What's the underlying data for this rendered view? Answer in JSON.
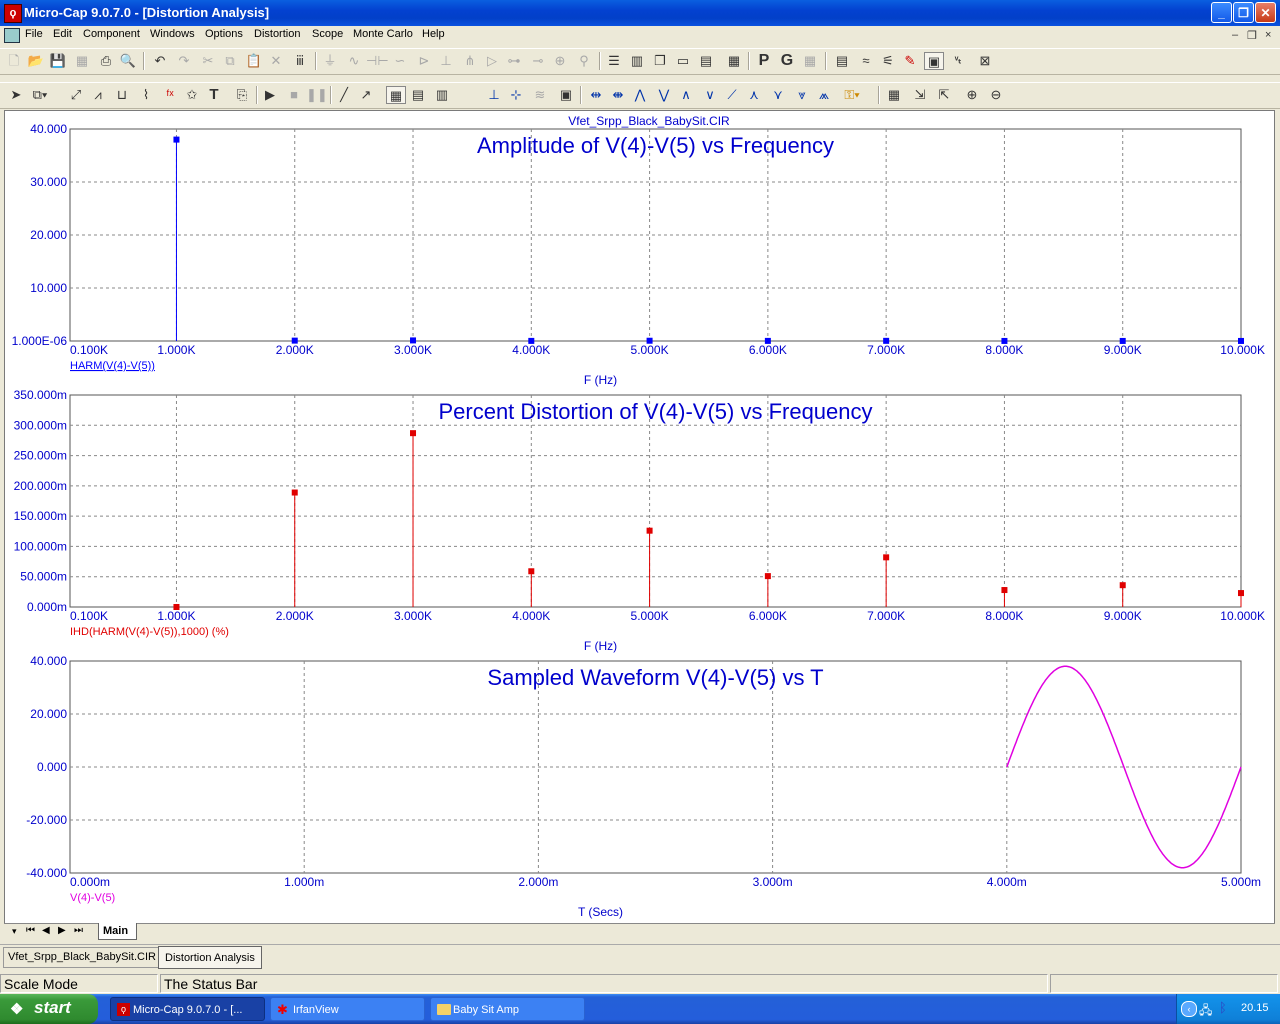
{
  "window": {
    "title": "Micro-Cap 9.0.7.0 - [Distortion Analysis]",
    "app_icon": "microcap-logo-icon",
    "buttons": [
      "minimize",
      "restore",
      "close"
    ]
  },
  "menu": [
    "File",
    "Edit",
    "Component",
    "Windows",
    "Options",
    "Distortion",
    "Scope",
    "Monte Carlo",
    "Help"
  ],
  "mdi_buttons": [
    "–",
    "❐",
    "×"
  ],
  "plot": {
    "circuit_name": "Vfet_Srpp_Black_BabySit.CIR",
    "panels": [
      {
        "title": "Amplitude of V(4)-V(5) vs Frequency",
        "y_ticks": [
          "40.000",
          "30.000",
          "20.000",
          "10.000",
          "1.000E-06"
        ],
        "x_ticks": [
          "0.100K",
          "1.000K",
          "2.000K",
          "3.000K",
          "4.000K",
          "5.000K",
          "6.000K",
          "7.000K",
          "8.000K",
          "9.000K",
          "10.000K"
        ],
        "xlabel": "F (Hz)",
        "expr": "HARM(V(4)-V(5))",
        "color": "#0000ff"
      },
      {
        "title": "Percent Distortion of V(4)-V(5) vs Frequency",
        "y_ticks": [
          "350.000m",
          "300.000m",
          "250.000m",
          "200.000m",
          "150.000m",
          "100.000m",
          "50.000m",
          "0.000m"
        ],
        "x_ticks": [
          "0.100K",
          "1.000K",
          "2.000K",
          "3.000K",
          "4.000K",
          "5.000K",
          "6.000K",
          "7.000K",
          "8.000K",
          "9.000K",
          "10.000K"
        ],
        "xlabel": "F (Hz)",
        "expr": "IHD(HARM(V(4)-V(5)),1000) (%)",
        "color": "#e00000"
      },
      {
        "title": "Sampled Waveform  V(4)-V(5) vs T",
        "y_ticks": [
          "40.000",
          "20.000",
          "0.000",
          "-20.000",
          "-40.000"
        ],
        "x_ticks": [
          "0.000m",
          "1.000m",
          "2.000m",
          "3.000m",
          "4.000m",
          "5.000m"
        ],
        "xlabel": "T (Secs)",
        "expr": "V(4)-V(5)",
        "color": "#e000e0"
      }
    ]
  },
  "chart_data": [
    {
      "type": "bar",
      "title": "Amplitude of V(4)-V(5) vs Frequency",
      "xlabel": "F (Hz)",
      "ylabel": "",
      "ylim": [
        0,
        40
      ],
      "xlim": [
        100,
        10000
      ],
      "x": [
        1000,
        2000,
        3000,
        4000,
        5000,
        6000,
        7000,
        8000,
        9000,
        10000
      ],
      "series": [
        {
          "name": "HARM(V(4)-V(5))",
          "values": [
            38.0,
            0.07,
            0.11,
            0.02,
            0.05,
            0.02,
            0.03,
            0.01,
            0.01,
            0.01
          ]
        }
      ]
    },
    {
      "type": "bar",
      "title": "Percent Distortion of V(4)-V(5) vs Frequency",
      "xlabel": "F (Hz)",
      "ylabel": "",
      "ylim": [
        0,
        0.35
      ],
      "xlim": [
        100,
        10000
      ],
      "x": [
        1000,
        2000,
        3000,
        4000,
        5000,
        6000,
        7000,
        8000,
        9000,
        10000
      ],
      "series": [
        {
          "name": "IHD(HARM(V(4)-V(5)),1000) (%)",
          "values": [
            0.0,
            0.189,
            0.287,
            0.059,
            0.126,
            0.051,
            0.082,
            0.028,
            0.036,
            0.023
          ]
        }
      ]
    },
    {
      "type": "line",
      "title": "Sampled Waveform  V(4)-V(5) vs T",
      "xlabel": "T (Secs)",
      "ylabel": "",
      "ylim": [
        -40,
        40
      ],
      "xlim": [
        0,
        0.005
      ],
      "series": [
        {
          "name": "V(4)-V(5)",
          "shape": "one sine cycle",
          "t_start": 0.004,
          "t_end": 0.005,
          "amplitude": 38,
          "offset": 0
        }
      ]
    }
  ],
  "sheet_tab": "Main",
  "doc_tabs": [
    "Vfet_Srpp_Black_BabySit.CIR",
    "Distortion Analysis"
  ],
  "status": {
    "mode": "Scale Mode",
    "text": "The Status Bar"
  },
  "taskbar": {
    "start": "start",
    "tasks": [
      "Micro-Cap 9.0.7.0 - [...",
      "IrfanView",
      "Baby Sit Amp"
    ],
    "clock": "20.15"
  }
}
